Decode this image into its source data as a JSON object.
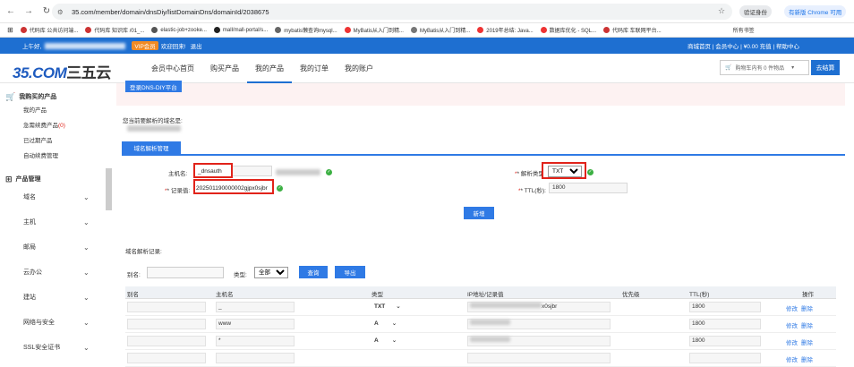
{
  "browser": {
    "url": "35.com/member/domain/dnsDiy/listDomainDns/domainId/2038675",
    "verify_label": "验证身份",
    "update_label": "有新版 Chrome 可用",
    "bookmarks": [
      "代码库 公共访问端...",
      "代码库 知识库 /01_...",
      "elastic-job+zooke...",
      "mall/mall-portal/s...",
      "mybatis懒查询mysql...",
      "MyBatis从入门到精...",
      "MyBatis从入门到精...",
      "2019年总结: Java...",
      "数据库优化 - SQL...",
      "代码库 车联网平台...",
      "所有书签"
    ]
  },
  "topstrip": {
    "greeting": "上午好,",
    "vip": "VIP会员",
    "welcome": "欢迎回来!",
    "logout": "退出",
    "links": "商城首页 | 会员中心 | ¥0.00 充值 | 帮助中心"
  },
  "header": {
    "logo_num": "35.COM",
    "logo_cn": "三五云",
    "nav": [
      "会员中心首页",
      "购买产品",
      "我的产品",
      "我的订单",
      "我的账户"
    ],
    "cart": "购物车内有 0 件物品",
    "checkout": "去结算"
  },
  "sidebar": {
    "sec1": "我购买的产品",
    "items": [
      "我的产品",
      "急需续费产品",
      "已过期产品",
      "自动续费管理"
    ],
    "urgent_count": "(0)",
    "sec2": "产品管理",
    "groups": [
      "域名",
      "主机",
      "邮局",
      "云办公",
      "建站",
      "网络与安全",
      "SSL安全证书"
    ]
  },
  "content": {
    "dns_button": "登录DNS-DIY平台",
    "domain_label": "您当前要解析的域名是:",
    "tab": "域名解析管理",
    "host_label": "主机名:",
    "host_value": "_dnsauth",
    "record_label": "* 记录值:",
    "record_value": "202501190000002gjpx0sjbr",
    "type_label": "* 解析类型:",
    "type_value": "TXT",
    "ttl_label": "* TTL(秒):",
    "ttl_value": "1800",
    "add_button": "新增",
    "records_label": "域名解析记录:",
    "filter_alias": "别名:",
    "filter_type": "类型:",
    "filter_type_value": "全部",
    "search_button": "查询",
    "export_button": "导出",
    "table_headers": [
      "别名",
      "主机名",
      "类型",
      "IP地址/记录值",
      "优先级",
      "TTL(秒)",
      "操作"
    ],
    "rows": [
      {
        "host": "_",
        "type": "TXT",
        "value": "x0sjbr",
        "ttl": "1800",
        "edit": "修改",
        "del": "删除"
      },
      {
        "host": "www",
        "type": "A",
        "value": "",
        "ttl": "1800",
        "edit": "修改",
        "del": "删除"
      },
      {
        "host": "*",
        "type": "A",
        "value": "",
        "ttl": "1800",
        "edit": "修改",
        "del": "删除"
      },
      {
        "host": "",
        "type": "",
        "value": "",
        "ttl": "",
        "edit": "修改",
        "del": "删除"
      }
    ]
  }
}
